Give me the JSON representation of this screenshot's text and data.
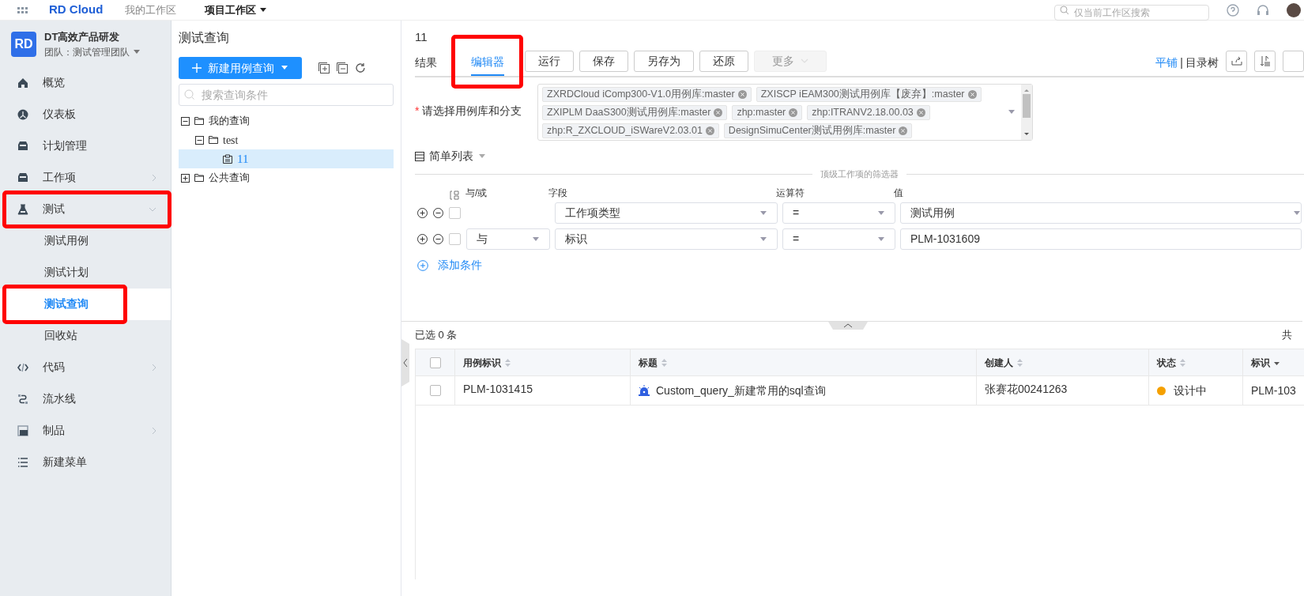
{
  "top_bar": {
    "logo": "RD Cloud",
    "nav": [
      {
        "label": "我的工作区",
        "selected": false
      },
      {
        "label": "项目工作区",
        "selected": true
      }
    ],
    "search": {
      "placeholder": "仅当前工作区搜索"
    }
  },
  "sidebar": {
    "team_logo": "RD",
    "team_name": "DT高效产品研发",
    "team": "团队：测试管理团队",
    "items": [
      {
        "label": "概览",
        "kind": "home",
        "expandable": false,
        "annotated": false
      },
      {
        "label": "仪表板",
        "kind": "dashboard",
        "expandable": false,
        "annotated": false
      },
      {
        "label": "计划管理",
        "kind": "tray",
        "expandable": false,
        "annotated": false
      },
      {
        "label": "工作项",
        "kind": "tray",
        "expandable": true,
        "expanded": false,
        "annotated": false
      },
      {
        "label": "测试",
        "kind": "flask",
        "expandable": true,
        "expanded": true,
        "annotated": true,
        "children": [
          {
            "label": "测试用例",
            "selected": false,
            "annotated": false
          },
          {
            "label": "测试计划",
            "selected": false,
            "annotated": false
          },
          {
            "label": "测试查询",
            "selected": true,
            "annotated": true
          },
          {
            "label": "回收站",
            "selected": false,
            "annotated": false
          }
        ]
      },
      {
        "label": "代码",
        "kind": "code",
        "expandable": true,
        "expanded": false,
        "annotated": false
      },
      {
        "label": "流水线",
        "kind": "pipeline",
        "expandable": false,
        "annotated": false
      },
      {
        "label": "制品",
        "kind": "product",
        "expandable": true,
        "expanded": false,
        "annotated": false
      },
      {
        "label": "新建菜单",
        "kind": "list",
        "expandable": false,
        "annotated": false
      }
    ]
  },
  "query_panel": {
    "title": "测试查询",
    "new_button": "新建用例查询",
    "search": {
      "placeholder": "搜索查询条件"
    },
    "tree": [
      {
        "label": "我的查询",
        "kind": "folder",
        "expanded": true,
        "selected": false,
        "children": [
          {
            "label": "test",
            "kind": "folder",
            "expanded": true,
            "selected": false,
            "children": [
              {
                "label": "11",
                "kind": "query",
                "selected": true
              }
            ]
          }
        ]
      },
      {
        "label": "公共查询",
        "kind": "folder",
        "expanded": false,
        "selected": false
      }
    ]
  },
  "editor": {
    "title": "11",
    "tabs": [
      {
        "label": "结果",
        "selected": false,
        "annotated": false
      },
      {
        "label": "编辑器",
        "selected": true,
        "annotated": true
      }
    ],
    "actions": [
      {
        "label": "运行",
        "disabled": false,
        "dropdown": false
      },
      {
        "label": "保存",
        "disabled": false,
        "dropdown": false
      },
      {
        "label": "另存为",
        "disabled": false,
        "dropdown": false
      },
      {
        "label": "还原",
        "disabled": false,
        "dropdown": false
      },
      {
        "label": "更多",
        "disabled": true,
        "dropdown": true
      }
    ],
    "view_modes": [
      {
        "label": "平铺",
        "selected": true
      },
      {
        "label": "目录树",
        "selected": false
      }
    ],
    "view_separator": "|",
    "library": {
      "label": "请选择用例库和分支",
      "required_mark": "*",
      "tags": [
        "ZXRDCloud iComp300-V1.0用例库:master",
        "ZXISCP iEAM300测试用例库【废弃】:master",
        "ZXIPLM DaaS300测试用例库:master",
        "zhp:master",
        "zhp:ITRANV2.18.00.03",
        "zhp:R_ZXCLOUD_iSWareV2.03.01",
        "DesignSimuCenter测试用例库:master"
      ]
    },
    "view_selector": "简单列表",
    "filter": {
      "title": "顶级工作项的筛选器",
      "columns": [
        "与/或",
        "字段",
        "运算符",
        "值"
      ],
      "rows": [
        {
          "checked": false,
          "field": "工作项类型",
          "operator": "=",
          "value": "测试用例",
          "kind": "select"
        },
        {
          "checked": false,
          "logic": "与",
          "field": "标识",
          "operator": "=",
          "value": "PLM-1031609",
          "kind": "input"
        }
      ],
      "add_label": "添加条件"
    }
  },
  "results": {
    "selected_count": "已选 0 条",
    "total": "共",
    "header_checked": false,
    "columns": [
      {
        "label": "用例标识",
        "sorted": false
      },
      {
        "label": "标题",
        "sorted": false
      },
      {
        "label": "创建人",
        "sorted": false
      },
      {
        "label": "状态",
        "sorted": false
      },
      {
        "label": "标识",
        "sorted": true
      }
    ],
    "rows": [
      {
        "checked": false,
        "id": "PLM-1031415",
        "title": "Custom_query_新建常用的sql查询",
        "creator": "张赛花00241263",
        "status": "设计中",
        "color": "#f5a000",
        "mark": "PLM-103"
      }
    ]
  }
}
